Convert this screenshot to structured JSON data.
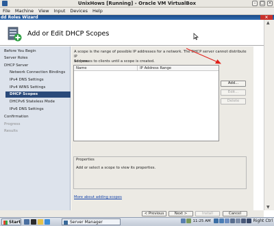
{
  "window": {
    "title": "UnixHows [Running] - Oracle VM VirtualBox"
  },
  "menubar": [
    "File",
    "Machine",
    "View",
    "Input",
    "Devices",
    "Help"
  ],
  "wizard": {
    "window_title": "dd Roles Wizard",
    "page_title": "Add or Edit DHCP Scopes",
    "nav": [
      {
        "label": "Before You Begin",
        "level": 0,
        "state": "normal"
      },
      {
        "label": "Server Roles",
        "level": 0,
        "state": "normal"
      },
      {
        "label": "DHCP Server",
        "level": 0,
        "state": "normal"
      },
      {
        "label": "Network Connection Bindings",
        "level": 1,
        "state": "normal"
      },
      {
        "label": "IPv4 DNS Settings",
        "level": 1,
        "state": "normal"
      },
      {
        "label": "IPv4 WINS Settings",
        "level": 1,
        "state": "normal"
      },
      {
        "label": "DHCP Scopes",
        "level": 1,
        "state": "active"
      },
      {
        "label": "DHCPv6 Stateless Mode",
        "level": 1,
        "state": "normal"
      },
      {
        "label": "IPv6 DNS Settings",
        "level": 1,
        "state": "normal"
      },
      {
        "label": "Confirmation",
        "level": 0,
        "state": "normal"
      },
      {
        "label": "Progress",
        "level": 0,
        "state": "disabled"
      },
      {
        "label": "Results",
        "level": 0,
        "state": "disabled"
      }
    ],
    "description_line1": "A scope is the range of possible IP addresses for a network. The DHCP server cannot distribute IP",
    "description_line2": "addresses to clients until a scope is created.",
    "scopes_label": "Scopes:",
    "columns": [
      "Name",
      "IP Address Range"
    ],
    "buttons": {
      "add": "Add...",
      "edit": "Edit...",
      "delete": "Delete"
    },
    "properties_title": "Properties",
    "properties_text": "Add or select a scope to view its properties.",
    "more_link": "More about adding scopes",
    "footer": {
      "previous": "< Previous",
      "next": "Next >",
      "install": "Install",
      "cancel": "Cancel"
    }
  },
  "taskbar": {
    "start": "Start",
    "task": "Server Manager",
    "clock": "11:25 AM",
    "host_key": "Right Ctrl"
  },
  "colors": {
    "annotation_arrow": "#e0201a",
    "selected_nav": "#2a4a7a",
    "link": "#0f3fa8"
  }
}
